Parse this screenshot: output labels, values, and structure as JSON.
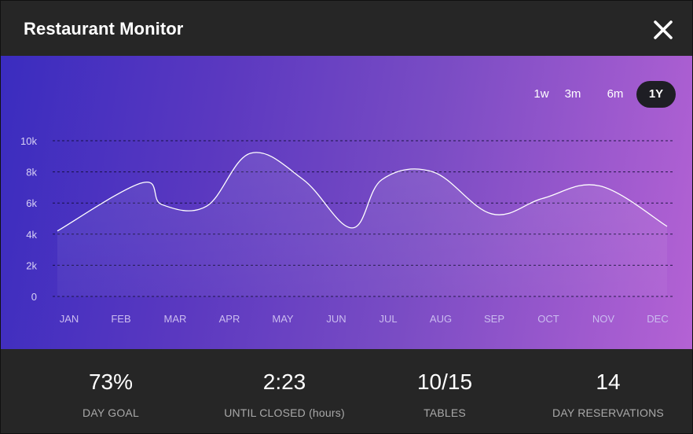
{
  "header": {
    "title": "Restaurant Monitor",
    "close_icon": "close-icon"
  },
  "range": {
    "options": [
      "1w",
      "3m",
      "6m",
      "1Y"
    ],
    "selected": "1Y"
  },
  "chart_data": {
    "type": "area",
    "categories": [
      "JAN",
      "FEB",
      "MAR",
      "APR",
      "MAY",
      "JUN",
      "JUL",
      "AUG",
      "SEP",
      "OCT",
      "NOV",
      "DEC"
    ],
    "y_ticks": [
      "10k",
      "8k",
      "6k",
      "4k",
      "2k",
      "0"
    ],
    "ylim": [
      0,
      10000
    ],
    "grid": true,
    "points": [
      {
        "x": "JAN",
        "y": 4200
      },
      {
        "x": "FEB",
        "y": 7300
      },
      {
        "x": "FEB-MAR",
        "y": 5900
      },
      {
        "x": "MAR-APR",
        "y": 5800
      },
      {
        "x": "APR-MAY",
        "y": 9200
      },
      {
        "x": "MAY",
        "y": 7500
      },
      {
        "x": "JUN",
        "y": 4400
      },
      {
        "x": "JUL",
        "y": 7500
      },
      {
        "x": "AUG",
        "y": 8000
      },
      {
        "x": "SEP",
        "y": 5300
      },
      {
        "x": "OCT",
        "y": 6300
      },
      {
        "x": "NOV",
        "y": 7100
      },
      {
        "x": "DEC",
        "y": 4500
      }
    ],
    "line_color": "#ffffff"
  },
  "stats": [
    {
      "value": "73%",
      "label": "DAY GOAL"
    },
    {
      "value": "2:23",
      "label": "UNTIL CLOSED (hours)"
    },
    {
      "value": "10/15",
      "label": "TABLES"
    },
    {
      "value": "14",
      "label": "DAY RESERVATIONS"
    }
  ]
}
